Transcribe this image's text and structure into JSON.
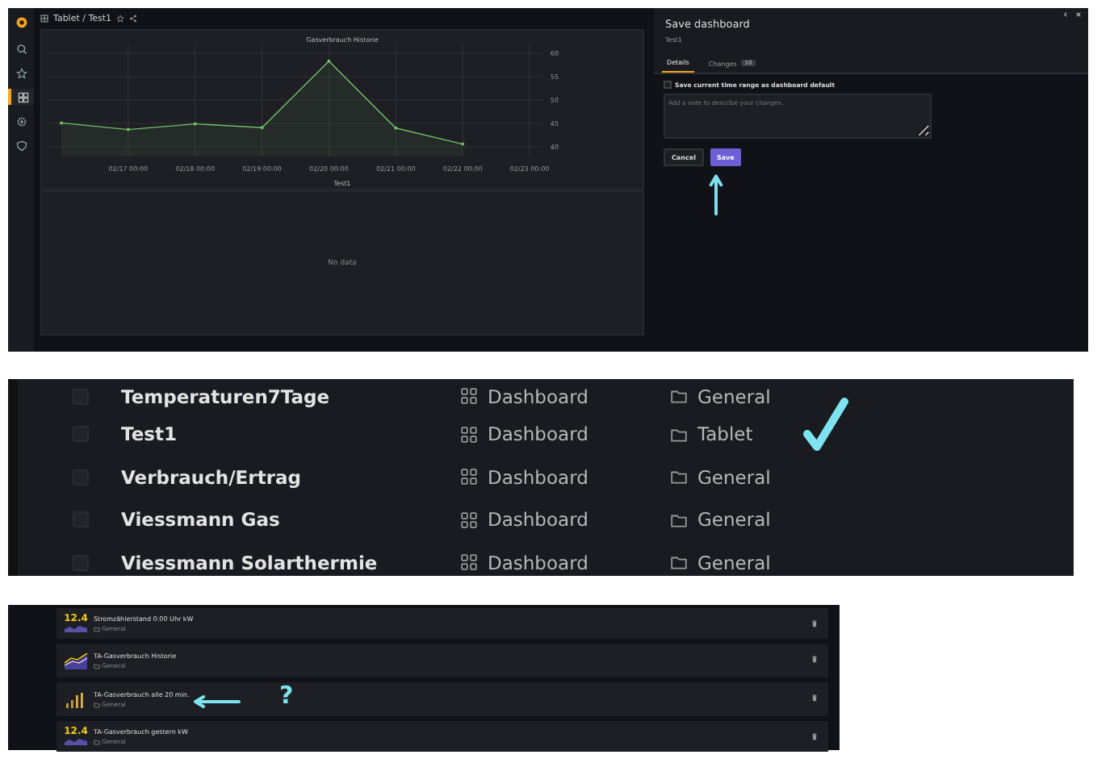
{
  "top": {
    "breadcrumb": "Tablet / Test1",
    "sidebar": [
      {
        "selected": false
      },
      {
        "selected": false
      },
      {
        "selected": true
      },
      {
        "selected": false
      },
      {
        "selected": false
      }
    ],
    "panel": {
      "title": "Gasverbrauch Historie",
      "chart_data": {
        "type": "area",
        "grid": true,
        "x": [
          null,
          "02/17 00:00",
          "02/18 00:00",
          "02/19 00:00",
          "02/20 00:00",
          "02/21 00:00",
          "02/22 00:00",
          "02/23 00:00"
        ],
        "yticks": [
          40,
          45,
          50,
          55,
          60
        ],
        "ylim": [
          40,
          60
        ],
        "series": [
          {
            "name": "Test1",
            "color": "#73bf69",
            "values": [
              45.1,
              43.7,
              44.9,
              44.1,
              58.3,
              44,
              40.6,
              null
            ]
          }
        ]
      }
    },
    "empty_panel": {
      "message": "No data"
    },
    "drawer": {
      "title": "Save dashboard",
      "subtitle": "Test1",
      "tabs": [
        {
          "label": "Details",
          "selected": true
        },
        {
          "label": "Changes",
          "badge": "10",
          "selected": false
        }
      ],
      "checkbox": {
        "label": "Save current time range as dashboard default",
        "checked": false
      },
      "note": {
        "placeholder": "Add a note to describe your changes."
      },
      "buttons": [
        {
          "label": "Cancel",
          "kind": "secondary"
        },
        {
          "label": "Save",
          "kind": "primary"
        }
      ]
    }
  },
  "list": {
    "rows": [
      {
        "name": "Temperaturen7Tage",
        "type": "Dashboard",
        "folder": "General",
        "checked": false
      },
      {
        "name": "Test1",
        "type": "Dashboard",
        "folder": "Tablet",
        "checked": false
      },
      {
        "name": "Verbrauch/Ertrag",
        "type": "Dashboard",
        "folder": "General",
        "checked": false
      },
      {
        "name": "Viessmann Gas",
        "type": "Dashboard",
        "folder": "General",
        "checked": false
      },
      {
        "name": "Viessmann Solarthermie",
        "type": "Dashboard",
        "folder": "General",
        "checked": false
      }
    ]
  },
  "library": {
    "note": "?",
    "items": [
      {
        "kind": "stat",
        "value": "12.4",
        "title": "Stromzählerstand 0:00 Uhr kW",
        "folder": "General"
      },
      {
        "kind": "graph",
        "title": "TA-Gasverbrauch Historie",
        "folder": "General"
      },
      {
        "kind": "bars",
        "title": "TA-Gasverbrauch alle 20 min.",
        "folder": "General"
      },
      {
        "kind": "stat",
        "value": "12.4",
        "title": "TA-Gasverbrauch gestern kW",
        "folder": "General"
      }
    ]
  }
}
